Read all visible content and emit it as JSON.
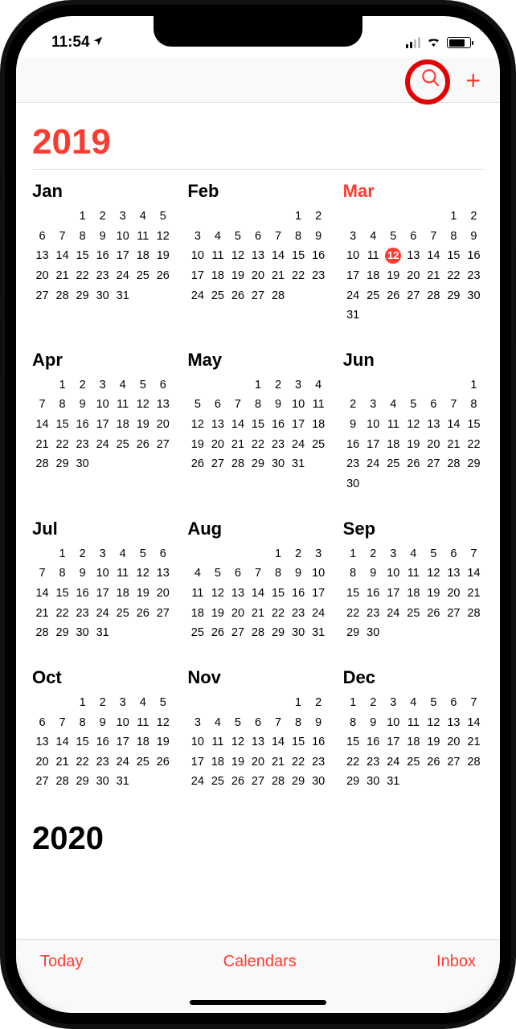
{
  "status": {
    "time": "11:54"
  },
  "year": "2019",
  "next_year": "2020",
  "today": {
    "month_index": 2,
    "day": 12
  },
  "toolbar": {
    "today": "Today",
    "calendars": "Calendars",
    "inbox": "Inbox"
  },
  "months": [
    {
      "name": "Jan",
      "start": 2,
      "days": 31
    },
    {
      "name": "Feb",
      "start": 5,
      "days": 28
    },
    {
      "name": "Mar",
      "start": 5,
      "days": 31
    },
    {
      "name": "Apr",
      "start": 1,
      "days": 30
    },
    {
      "name": "May",
      "start": 3,
      "days": 31
    },
    {
      "name": "Jun",
      "start": 6,
      "days": 30
    },
    {
      "name": "Jul",
      "start": 1,
      "days": 31
    },
    {
      "name": "Aug",
      "start": 4,
      "days": 31
    },
    {
      "name": "Sep",
      "start": 0,
      "days": 30
    },
    {
      "name": "Oct",
      "start": 2,
      "days": 31
    },
    {
      "name": "Nov",
      "start": 5,
      "days": 30
    },
    {
      "name": "Dec",
      "start": 0,
      "days": 31
    }
  ],
  "annotation": {
    "highlight_target": "search-button"
  }
}
